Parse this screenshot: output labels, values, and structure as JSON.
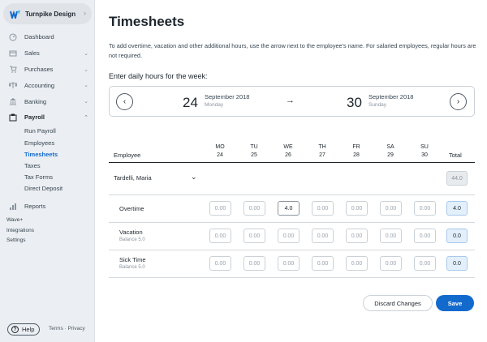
{
  "sidebar": {
    "business_name": "Turnpike Design",
    "items": [
      {
        "label": "Dashboard",
        "icon": "dashboard-icon"
      },
      {
        "label": "Sales",
        "icon": "sales-icon"
      },
      {
        "label": "Purchases",
        "icon": "purchases-icon"
      },
      {
        "label": "Accounting",
        "icon": "accounting-icon"
      },
      {
        "label": "Banking",
        "icon": "banking-icon"
      },
      {
        "label": "Payroll",
        "icon": "payroll-icon"
      }
    ],
    "payroll_sub": [
      "Run Payroll",
      "Employees",
      "Timesheets",
      "Taxes",
      "Tax Forms",
      "Direct Deposit"
    ],
    "reports": "Reports",
    "misc": [
      "Wave+",
      "Integrations",
      "Settings"
    ],
    "help": "Help",
    "footer": "Terms · Privacy"
  },
  "main": {
    "title": "Timesheets",
    "intro": "To add overtime, vacation and other additional hours, use the arrow next to the employee's name. For salaried employees, regular hours are not required.",
    "enter_label": "Enter daily hours for the week:",
    "week": {
      "start_day": "24",
      "start_month": "September 2018",
      "start_dow": "Monday",
      "end_day": "30",
      "end_month": "September 2018",
      "end_dow": "Sunday"
    },
    "columns": {
      "employee": "Employee",
      "total": "Total",
      "days": [
        {
          "dow": "MO",
          "date": "24"
        },
        {
          "dow": "TU",
          "date": "25"
        },
        {
          "dow": "WE",
          "date": "26"
        },
        {
          "dow": "TH",
          "date": "27"
        },
        {
          "dow": "FR",
          "date": "28"
        },
        {
          "dow": "SA",
          "date": "29"
        },
        {
          "dow": "SU",
          "date": "30"
        }
      ]
    },
    "employee_name": "Tardelli, Maria",
    "employee_total": "44.0",
    "rows": [
      {
        "label": "Overtime",
        "sub": "",
        "values": [
          "0.00",
          "0.00",
          "4.0",
          "0.00",
          "0.00",
          "0.00",
          "0.00"
        ],
        "total": "4.0"
      },
      {
        "label": "Vacation",
        "sub": "Balance 5.0",
        "values": [
          "0.00",
          "0.00",
          "0.00",
          "0.00",
          "0.00",
          "0.00",
          "0.00"
        ],
        "total": "0.0"
      },
      {
        "label": "Sick Time",
        "sub": "Balance 5.0",
        "values": [
          "0.00",
          "0.00",
          "0.00",
          "0.00",
          "0.00",
          "0.00",
          "0.00"
        ],
        "total": "0.0"
      }
    ],
    "discard_label": "Discard Changes",
    "save_label": "Save"
  },
  "colors": {
    "accent": "#136acd",
    "sidebar_bg": "#ebeef2"
  }
}
